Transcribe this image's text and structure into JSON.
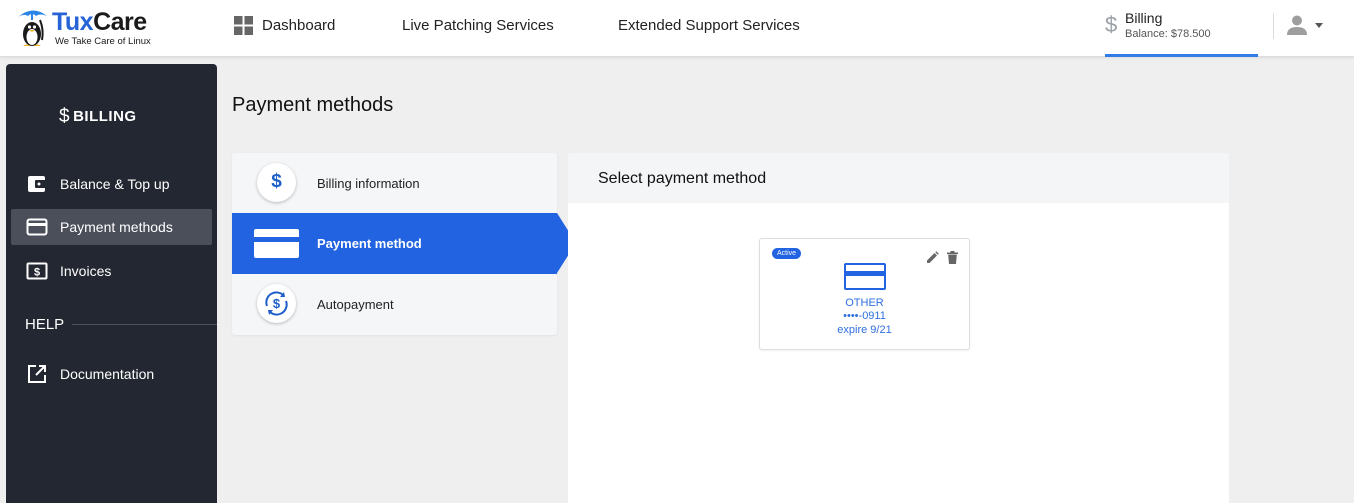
{
  "header": {
    "logo": {
      "brand_part1": "Tux",
      "brand_part2": "Care",
      "tagline": "We Take Care of Linux"
    },
    "nav": [
      {
        "label": "Dashboard",
        "icon": "grid-icon"
      },
      {
        "label": "Live Patching Services"
      },
      {
        "label": "Extended Support Services"
      }
    ],
    "billing": {
      "icon": "dollar-icon",
      "title": "Billing",
      "balance": "Balance:  $78.500"
    },
    "user": {
      "icon": "person-icon",
      "caret_icon": "caret-down-icon"
    }
  },
  "sidebar": {
    "title": "BILLING",
    "title_icon": "dollar-icon",
    "items": [
      {
        "label": "Balance & Top up",
        "icon": "wallet-icon",
        "active": false
      },
      {
        "label": "Payment methods",
        "icon": "credit-card-icon",
        "active": true
      },
      {
        "label": "Invoices",
        "icon": "invoice-icon",
        "active": false
      }
    ],
    "help_heading": "HELP",
    "help_items": [
      {
        "label": "Documentation",
        "icon": "external-link-icon"
      }
    ]
  },
  "main": {
    "page_title": "Payment methods",
    "steps": [
      {
        "label": "Billing information",
        "icon": "dollar-icon",
        "active": false
      },
      {
        "label": "Payment method",
        "icon": "credit-card-icon",
        "active": true
      },
      {
        "label": "Autopayment",
        "icon": "autopay-icon",
        "active": false
      }
    ],
    "panel": {
      "title": "Select payment method",
      "card": {
        "badge": "Active",
        "type": "OTHER",
        "number": "••••-0911",
        "expiry": "expire 9/21",
        "edit_icon": "pencil-icon",
        "delete_icon": "trash-icon"
      }
    }
  },
  "colors": {
    "accent": "#2163e0",
    "sidebar_bg": "#232731",
    "sidebar_active": "#4a4f5a",
    "page_bg": "#efefef"
  }
}
